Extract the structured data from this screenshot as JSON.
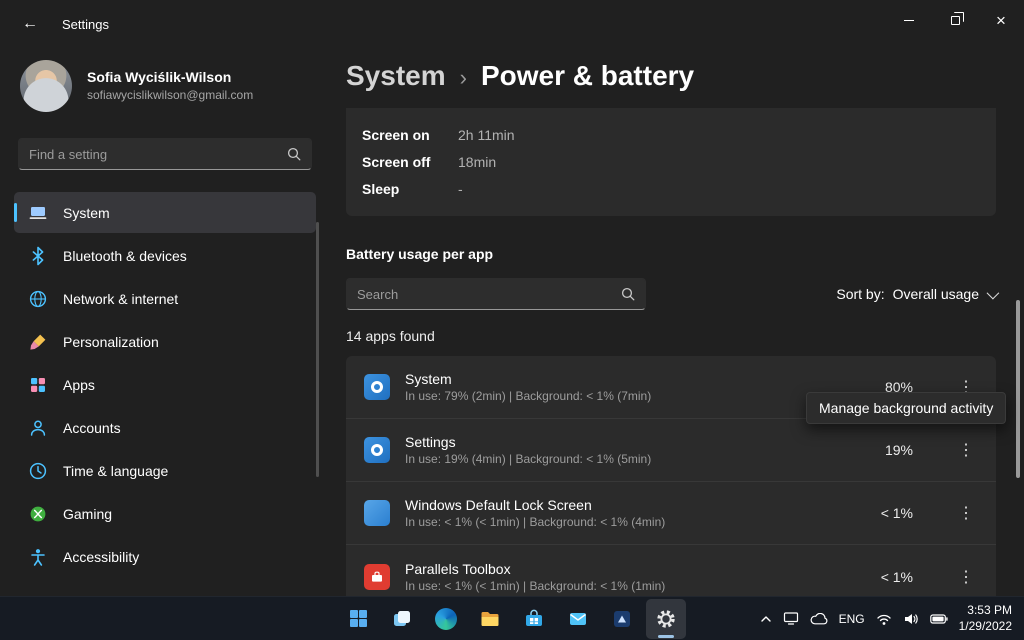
{
  "titlebar": {
    "title": "Settings"
  },
  "icons": {
    "back": "←",
    "close": "×",
    "kebab": "⋮"
  },
  "profile": {
    "name": "Sofia Wyciślik-Wilson",
    "email": "sofiawycislikwilson@gmail.com"
  },
  "sidebar": {
    "search_placeholder": "Find a setting",
    "items": [
      {
        "label": "System"
      },
      {
        "label": "Bluetooth & devices"
      },
      {
        "label": "Network & internet"
      },
      {
        "label": "Personalization"
      },
      {
        "label": "Apps"
      },
      {
        "label": "Accounts"
      },
      {
        "label": "Time & language"
      },
      {
        "label": "Gaming"
      },
      {
        "label": "Accessibility"
      }
    ]
  },
  "breadcrumb": {
    "parent": "System",
    "separator": "›",
    "current": "Power & battery"
  },
  "stats": [
    {
      "label": "Screen on",
      "value": "2h 11min"
    },
    {
      "label": "Screen off",
      "value": "18min"
    },
    {
      "label": "Sleep",
      "value": "-"
    }
  ],
  "battery_usage": {
    "title": "Battery usage per app",
    "search_placeholder": "Search",
    "sort_label": "Sort by:",
    "sort_value": "Overall usage",
    "apps_found": "14 apps found",
    "apps": [
      {
        "name": "System",
        "details": "In use: 79% (2min) | Background: < 1% (7min)",
        "percent": "80%"
      },
      {
        "name": "Settings",
        "details": "In use: 19% (4min) | Background: < 1% (5min)",
        "percent": "19%"
      },
      {
        "name": "Windows Default Lock Screen",
        "details": "In use: < 1% (< 1min) | Background: < 1% (4min)",
        "percent": "< 1%"
      },
      {
        "name": "Parallels Toolbox",
        "details": "In use: < 1% (< 1min) | Background: < 1% (1min)",
        "percent": "< 1%"
      }
    ]
  },
  "tooltip": {
    "text": "Manage background activity"
  },
  "taskbar": {
    "language": "ENG",
    "time": "3:53 PM",
    "date": "1/29/2022"
  }
}
